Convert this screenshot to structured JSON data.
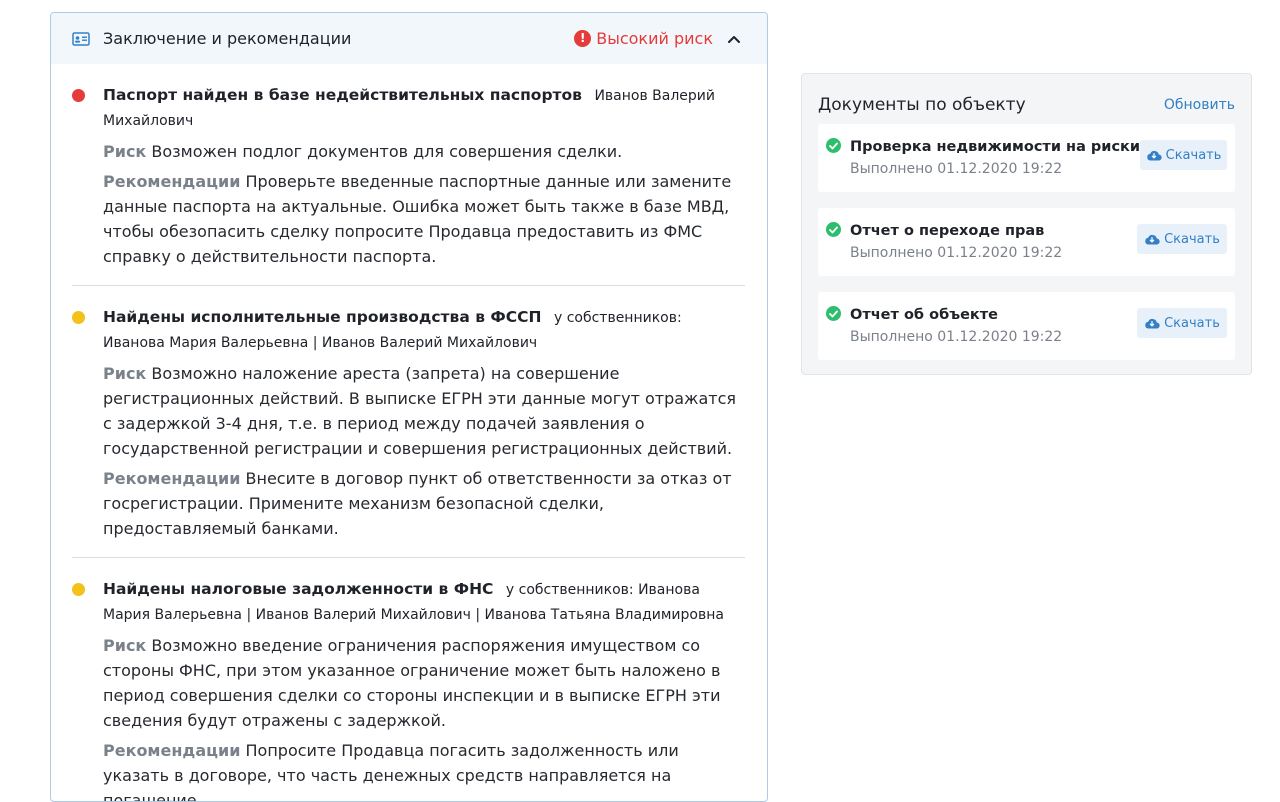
{
  "conclusion": {
    "title": "Заключение и рекомендации",
    "risk_label": "Высокий риск",
    "risk_color": "#e53b3b",
    "findings": [
      {
        "severity": "red",
        "title": "Паспорт найден в базе недействительных паспортов",
        "subject": "Иванов Валерий Михайлович",
        "risk_label": "Риск",
        "risk_text": "Возможен подлог документов для совершения сделки.",
        "rec_label": "Рекомендации",
        "rec_text": "Проверьте введенные паспортные данные или замените данные паспорта на актуальные. Ошибка может быть также в базе МВД, чтобы обезопасить сделку попросите Продавца предоставить из ФМС справку о действительности паспорта."
      },
      {
        "severity": "yellow",
        "title": "Найдены исполнительные производства в ФССП",
        "subject": "у собственников: Иванова Мария Валерьевна | Иванов Валерий Михайлович",
        "risk_label": "Риск",
        "risk_text": "Возможно наложение ареста (запрета) на совершение регистрационных действий. В выписке ЕГРН эти данные могут отражатся с задержкой 3-4 дня, т.е. в период между подачей заявления о государственной регистрации и совершения регистрационных действий.",
        "rec_label": "Рекомендации",
        "rec_text": "Внесите в договор пункт об ответственности за отказ от госрегистрации. Примените механизм безопасной сделки, предоставляемый банками."
      },
      {
        "severity": "yellow",
        "title": "Найдены налоговые задолженности в ФНС",
        "subject": "у собственников: Иванова Мария Валерьевна | Иванов Валерий Михайлович | Иванова Татьяна Владимировна",
        "risk_label": "Риск",
        "risk_text": "Возможно введение ограничения распоряжения имуществом со стороны ФНС, при этом указанное ограничение может быть наложено в период совершения сделки со стороны инспекции и в выписке ЕГРН эти сведения будут отражены с задержкой.",
        "rec_label": "Рекомендации",
        "rec_text": "Попросите Продавца погасить задолженность или указать в договоре, что часть денежных средств направляется на погашение"
      }
    ]
  },
  "documents": {
    "title": "Документы по объекту",
    "refresh_label": "Обновить",
    "download_label": "Скачать",
    "items": [
      {
        "name": "Проверка недвижимости на риски",
        "status": "Выполнено 01.12.2020 19:22"
      },
      {
        "name": "Отчет о переходе прав",
        "status": "Выполнено 01.12.2020 19:22"
      },
      {
        "name": "Отчет об объекте",
        "status": "Выполнено 01.12.2020 19:22"
      }
    ]
  }
}
